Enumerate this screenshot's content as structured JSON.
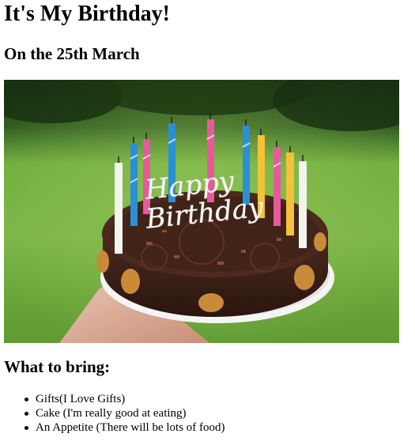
{
  "page": {
    "title": "It's My Birthday!",
    "date_heading": "On the 25th March",
    "photo": {
      "description_icon": "birthday-cake-photo",
      "cake_text_line1": "Happy",
      "cake_text_line2": "Birthday"
    },
    "bring_heading": "What to bring:",
    "items": [
      "Gifts(I Love Gifts)",
      "Cake (I'm really good at eating)",
      "An Appetite (There will be lots of food)"
    ]
  },
  "colors": {
    "background": "#ffffff",
    "text": "#000000",
    "grass": "#6aa83a",
    "chocolate": "#3a1f16",
    "plate": "#f2f2f2"
  }
}
